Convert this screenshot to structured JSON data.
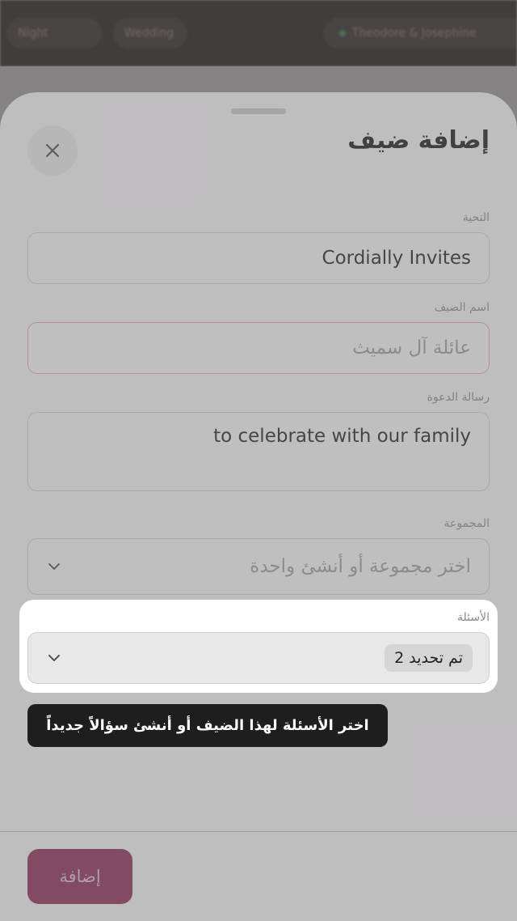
{
  "background": {
    "chip_a": "Night",
    "chip_b": "Wedding",
    "chip_c": "Theodore & Josephine"
  },
  "sheet": {
    "title": "إضافة ضيف",
    "close_icon": "close-icon"
  },
  "fields": {
    "greeting_label": "التحية",
    "greeting_value": "Cordially Invites",
    "guest_name_label": "اسم الضيف",
    "guest_name_placeholder": "عائلة آل سميث",
    "invite_message_label": "رسالة الدعوة",
    "invite_message_value": "to celebrate with our family",
    "group_label": "المجموعة",
    "group_placeholder": "اختر مجموعة أو أنشئ واحدة"
  },
  "questions": {
    "label": "الأسئلة",
    "selected_text": "تم تحديد 2"
  },
  "tooltip": {
    "text": "اختر الأسئلة لهذا الضيف أو أنشئ سؤالاً جديداً"
  },
  "footer": {
    "add_label": "إضافة"
  },
  "colors": {
    "accent": "#8a2c55",
    "error_border": "#e2a3b4",
    "tooltip_bg": "#1f1e1f"
  }
}
